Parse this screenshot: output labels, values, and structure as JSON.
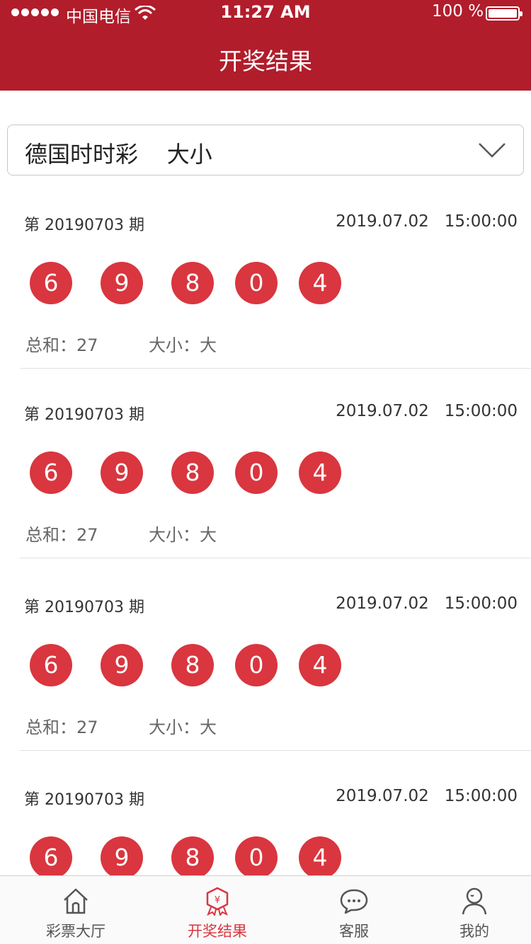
{
  "status_bar": {
    "carrier": "中国电信",
    "time": "11:27 AM",
    "battery": "100 %"
  },
  "nav": {
    "title": "开奖结果"
  },
  "selector": {
    "value": "德国时时彩    大小"
  },
  "draws": [
    {
      "issue": "第 20190703 期",
      "datetime": "2019.07.02   15:00:00",
      "numbers": [
        "6",
        "9",
        "8",
        "0",
        "4"
      ],
      "sum": "总和：27",
      "size": "大小：大"
    },
    {
      "issue": "第 20190703 期",
      "datetime": "2019.07.02   15:00:00",
      "numbers": [
        "6",
        "9",
        "8",
        "0",
        "4"
      ],
      "sum": "总和：27",
      "size": "大小：大"
    },
    {
      "issue": "第 20190703 期",
      "datetime": "2019.07.02   15:00:00",
      "numbers": [
        "6",
        "9",
        "8",
        "0",
        "4"
      ],
      "sum": "总和：27",
      "size": "大小：大"
    },
    {
      "issue": "第 20190703 期",
      "datetime": "2019.07.02   15:00:00",
      "numbers": [
        "6",
        "9",
        "8",
        "0",
        "4"
      ],
      "sum": "",
      "size": ""
    }
  ],
  "tabbar": {
    "items": [
      {
        "label": "彩票大厅",
        "icon": "home-icon",
        "active": false
      },
      {
        "label": "开奖结果",
        "icon": "lottery-result-icon",
        "active": true
      },
      {
        "label": "客服",
        "icon": "chat-bubble-icon",
        "active": false
      },
      {
        "label": "我的",
        "icon": "user-profile-icon",
        "active": false
      }
    ]
  },
  "colors": {
    "header": "#b11d2b",
    "ball": "#d9363f",
    "active_tab": "#d9363f"
  }
}
